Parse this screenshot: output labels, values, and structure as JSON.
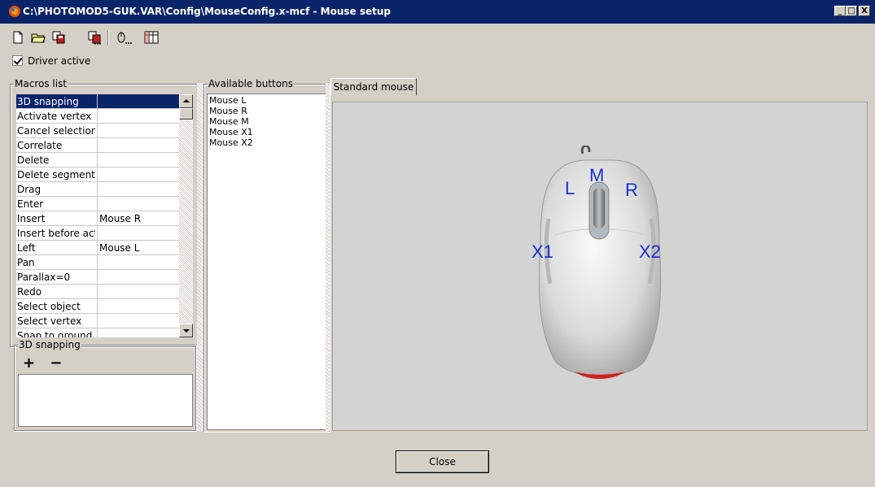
{
  "window": {
    "title": "C:\\PHOTOMOD5-GUK.VAR\\Config\\MouseConfig.x-mcf - Mouse setup",
    "controls": [
      "_",
      "□",
      "X"
    ]
  },
  "toolbar": {
    "icons": [
      "new-file-icon",
      "open-folder-icon",
      "save-icon",
      "save-as-icon",
      "mouse-settings-icon",
      "grid-icon"
    ]
  },
  "driver": {
    "label": "Driver active",
    "checked": true
  },
  "macros": {
    "legend": "Macros list",
    "rows": [
      {
        "name": "3D snapping",
        "button": "",
        "selected": true
      },
      {
        "name": "Activate vertex",
        "button": ""
      },
      {
        "name": "Cancel selection",
        "button": ""
      },
      {
        "name": "Correlate",
        "button": ""
      },
      {
        "name": "Delete",
        "button": ""
      },
      {
        "name": "Delete segment",
        "button": ""
      },
      {
        "name": "Drag",
        "button": ""
      },
      {
        "name": "Enter",
        "button": ""
      },
      {
        "name": "Insert",
        "button": "Mouse R"
      },
      {
        "name": "Insert before activ",
        "button": ""
      },
      {
        "name": "Left",
        "button": "Mouse L"
      },
      {
        "name": "Pan",
        "button": ""
      },
      {
        "name": "Parallax=0",
        "button": ""
      },
      {
        "name": "Redo",
        "button": ""
      },
      {
        "name": "Select object",
        "button": ""
      },
      {
        "name": "Select vertex",
        "button": ""
      },
      {
        "name": "Snap to ground",
        "button": ""
      }
    ]
  },
  "snapping": {
    "legend": "3D snapping",
    "add": "+",
    "remove": "−"
  },
  "available": {
    "legend": "Available buttons",
    "items": [
      "Mouse L",
      "Mouse R",
      "Mouse M",
      "Mouse X1",
      "Mouse X2"
    ]
  },
  "tab": {
    "label": "Standard mouse"
  },
  "mouse_labels": {
    "left": "L",
    "middle": "M",
    "right": "R",
    "x1": "X1",
    "x2": "X2"
  },
  "close_label": "Close",
  "colors": {
    "title_bar": "#0a246a",
    "selection": "#0a246a",
    "face": "#d4d0c8",
    "label_blue": "#1a2fd0"
  }
}
